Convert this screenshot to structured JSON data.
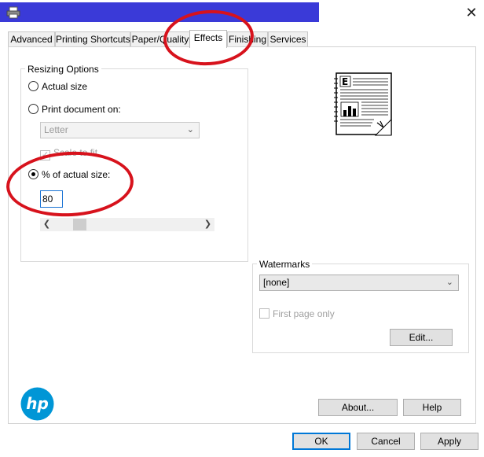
{
  "tabs": [
    {
      "label": "Advanced"
    },
    {
      "label": "Printing Shortcuts"
    },
    {
      "label": "Paper/Quality"
    },
    {
      "label": "Effects"
    },
    {
      "label": "Finishing"
    },
    {
      "label": "Services"
    }
  ],
  "resizing": {
    "group_label": "Resizing Options",
    "actual_size_label": "Actual size",
    "print_on_label": "Print document on:",
    "paper_value": "Letter",
    "scale_to_fit_label": "Scale to fit",
    "percent_label": "% of actual size:",
    "percent_value": "80"
  },
  "watermarks": {
    "group_label": "Watermarks",
    "value": "[none]",
    "first_page_label": "First page only",
    "edit_label": "Edit..."
  },
  "buttons": {
    "about": "About...",
    "help": "Help",
    "ok": "OK",
    "cancel": "Cancel",
    "apply": "Apply"
  },
  "preview": {
    "letter": "E"
  },
  "colors": {
    "accent": "#0078d7",
    "annotation_red": "#d7121c",
    "hp_blue": "#0096d6",
    "title_bar_blue": "#3a3ad8"
  },
  "icons": [
    "printer-icon",
    "close-icon",
    "chevron-down-icon",
    "scroll-left-icon",
    "scroll-right-icon",
    "hp-logo",
    "page-preview-icon"
  ]
}
